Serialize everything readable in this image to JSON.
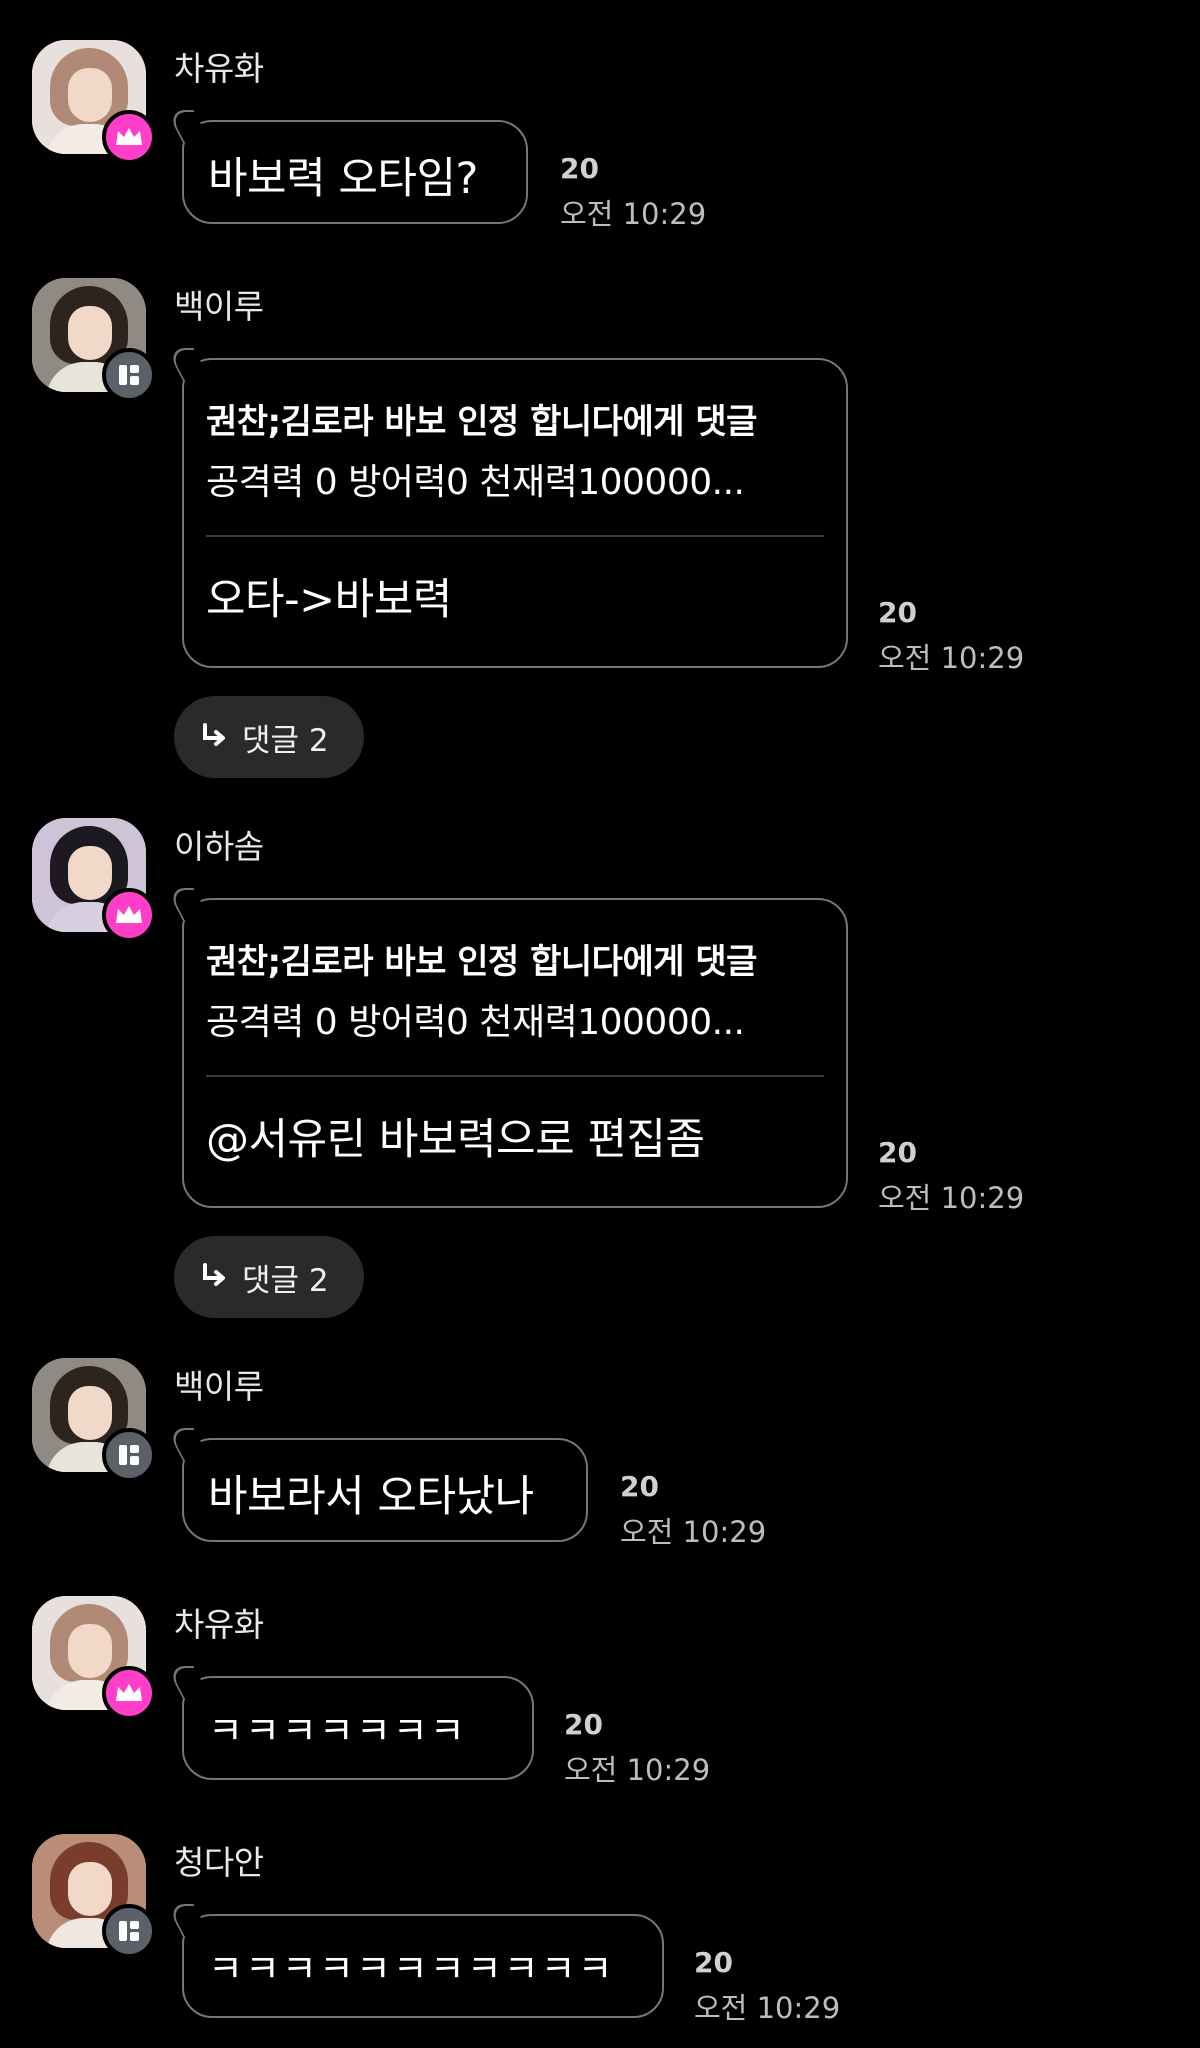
{
  "messages": [
    {
      "sender": "차유화",
      "avatar": "avatar-chayuhwa",
      "badge": "crown-icon",
      "text": "바보력 오타임?",
      "count": "20",
      "time": "오전 10:29"
    },
    {
      "sender": "백이루",
      "avatar": "avatar-baekiru",
      "badge": "member-icon",
      "quote_title": "권찬;김로라 바보 인정 합니다에게 댓글",
      "quote_body": "공격력 0 방어력0 천재력100000...",
      "text": "오타->바보력",
      "count": "20",
      "time": "오전 10:29",
      "replies": "댓글 2"
    },
    {
      "sender": "이하솜",
      "avatar": "avatar-ihasom",
      "badge": "crown-icon",
      "quote_title": "권찬;김로라 바보 인정 합니다에게 댓글",
      "quote_body": "공격력 0 방어력0 천재력100000...",
      "text": "@서유린 바보력으로 편집좀",
      "count": "20",
      "time": "오전 10:29",
      "replies": "댓글 2"
    },
    {
      "sender": "백이루",
      "avatar": "avatar-baekiru",
      "badge": "member-icon",
      "text": "바보라서 오타났나",
      "count": "20",
      "time": "오전 10:29"
    },
    {
      "sender": "차유화",
      "avatar": "avatar-chayuhwa",
      "badge": "crown-icon",
      "text": "ㅋㅋㅋㅋㅋㅋㅋ",
      "count": "20",
      "time": "오전 10:29"
    },
    {
      "sender": "청다안",
      "avatar": "avatar-cheongdaan",
      "badge": "member-icon",
      "text": "ㅋㅋㅋㅋㅋㅋㅋㅋㅋㅋㅋ",
      "count": "20",
      "time": "오전 10:29"
    }
  ],
  "colors": {
    "crown_badge": "#ff3fc8",
    "member_badge": "#5c6169",
    "bubble_border": "#767676",
    "reply_button": "#2a2a2a"
  }
}
